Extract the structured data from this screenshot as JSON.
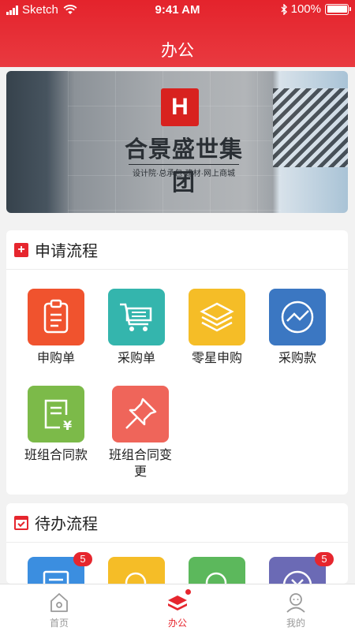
{
  "status_bar": {
    "carrier": "Sketch",
    "time": "9:41 AM",
    "battery": "100%"
  },
  "nav": {
    "title": "办公"
  },
  "banner": {
    "company_name": "合景盛世集团",
    "slogan": "设计院·总承包·建材·网上商城"
  },
  "apply_section": {
    "title": "申请流程",
    "items": [
      {
        "label": "申购单",
        "icon": "clipboard-icon",
        "color": "#f0532e"
      },
      {
        "label": "采购单",
        "icon": "cart-icon",
        "color": "#34b5ad"
      },
      {
        "label": "零星申购",
        "icon": "layers-icon",
        "color": "#f5bd27"
      },
      {
        "label": "采购款",
        "icon": "chart-icon",
        "color": "#3b77c2"
      },
      {
        "label": "班组合同款",
        "icon": "contract-yen-icon",
        "color": "#7cba49"
      },
      {
        "label": "班组合同变更",
        "icon": "pin-icon",
        "color": "#ef655a"
      }
    ]
  },
  "todo_section": {
    "title": "待办流程",
    "items": [
      {
        "badge": "5",
        "icon": "document-icon",
        "color": "#3b8ee0"
      },
      {
        "badge": "",
        "icon": "search-icon",
        "color": "#f5bd27"
      },
      {
        "badge": "",
        "icon": "search-icon",
        "color": "#5cb85c"
      },
      {
        "badge": "5",
        "icon": "close-circle-icon",
        "color": "#6b6ab5"
      }
    ]
  },
  "tabbar": {
    "tabs": [
      {
        "label": "首页",
        "icon": "home-icon",
        "active": false
      },
      {
        "label": "办公",
        "icon": "books-icon",
        "active": true
      },
      {
        "label": "我的",
        "icon": "user-icon",
        "active": false
      }
    ]
  },
  "colors": {
    "brand_red": "#e6262e",
    "inactive_gray": "#9a9a9a"
  }
}
